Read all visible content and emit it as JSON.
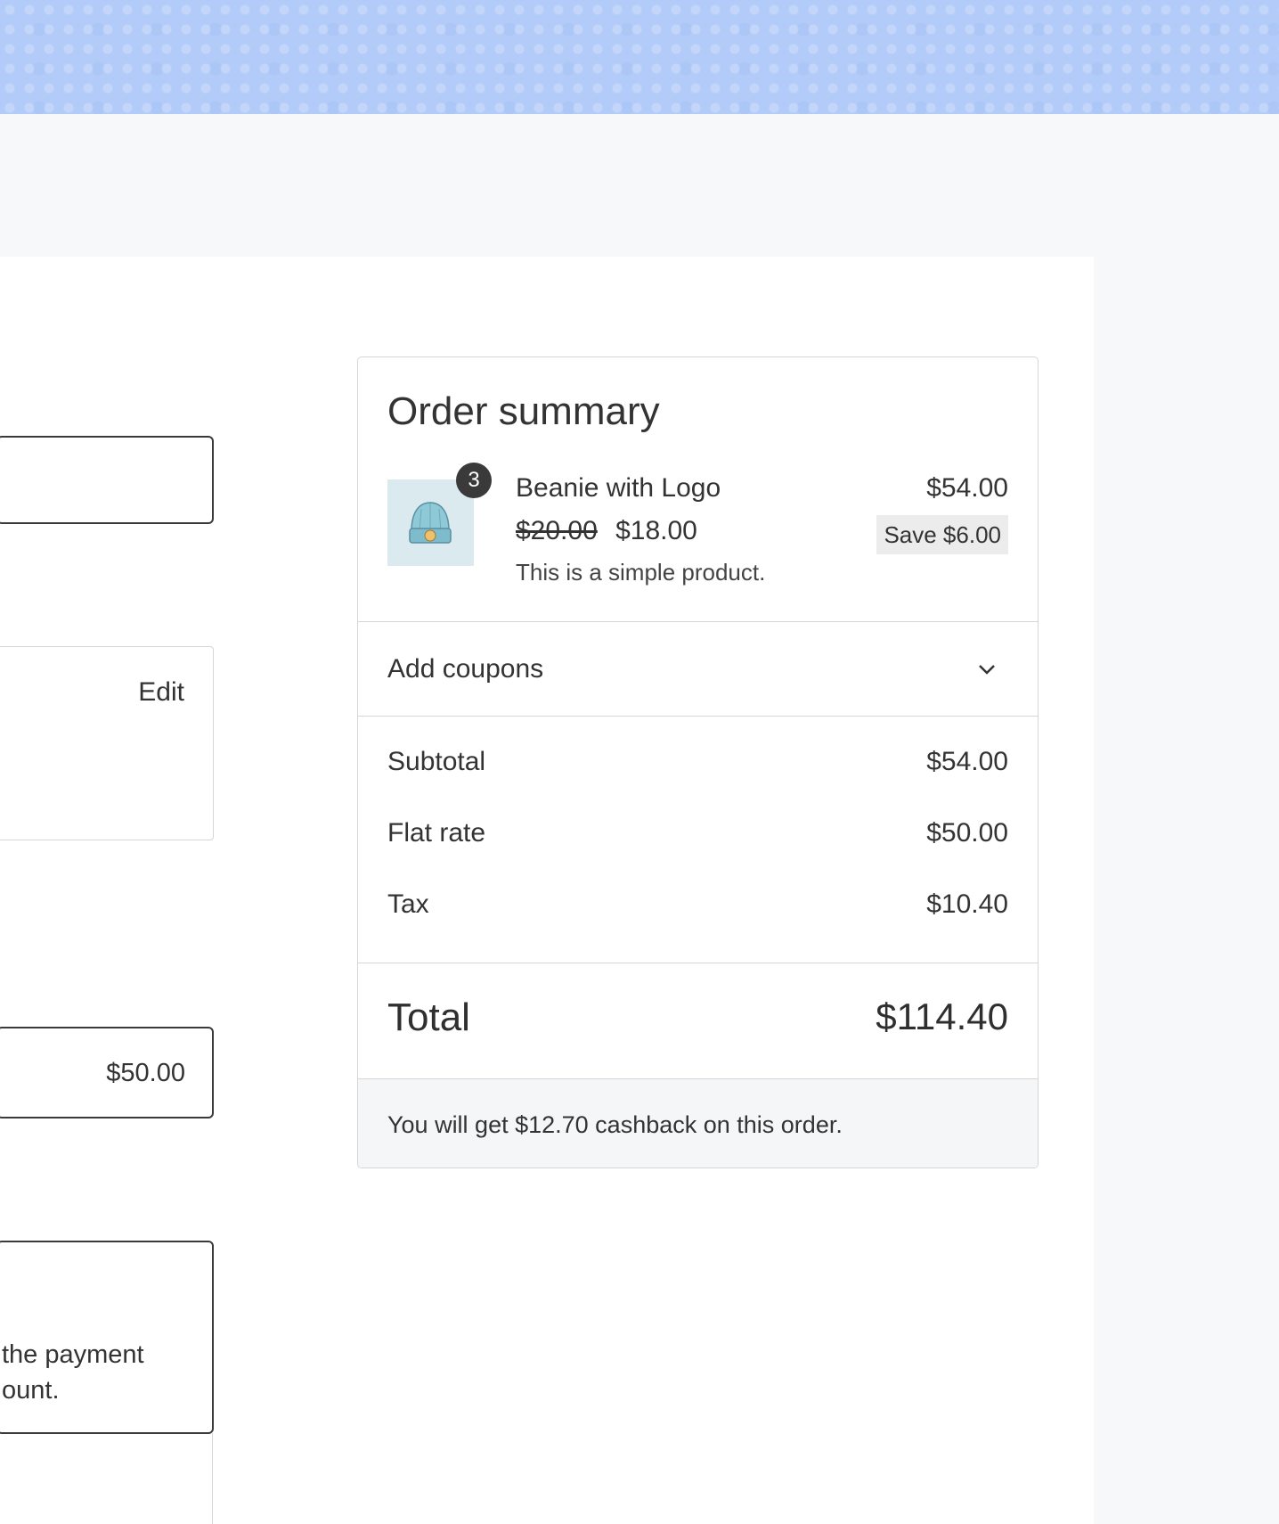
{
  "left_column": {
    "address_edit_label": "Edit",
    "shipping_option_price": "$50.00",
    "payment_text_line1": "the payment",
    "payment_text_line2": "ount."
  },
  "order_summary": {
    "title": "Order summary",
    "item": {
      "quantity": "3",
      "name": "Beanie with Logo",
      "original_price": "$20.00",
      "sale_price": "$18.00",
      "description": "This is a simple product.",
      "line_total": "$54.00",
      "save_label": "Save $6.00"
    },
    "coupons_label": "Add coupons",
    "rows": [
      {
        "label": "Subtotal",
        "value": "$54.00"
      },
      {
        "label": "Flat rate",
        "value": "$50.00"
      },
      {
        "label": "Tax",
        "value": "$10.40"
      }
    ],
    "total_label": "Total",
    "total_value": "$114.40",
    "cashback_text": "You will get $12.70 cashback on this order."
  },
  "colors": {
    "hero_background": "#b2cbf8",
    "text": "#333333",
    "badge": "#3a3a3a"
  },
  "icons": {
    "product_thumbnail": "beanie-image",
    "coupons_toggle": "chevron-down-icon"
  }
}
